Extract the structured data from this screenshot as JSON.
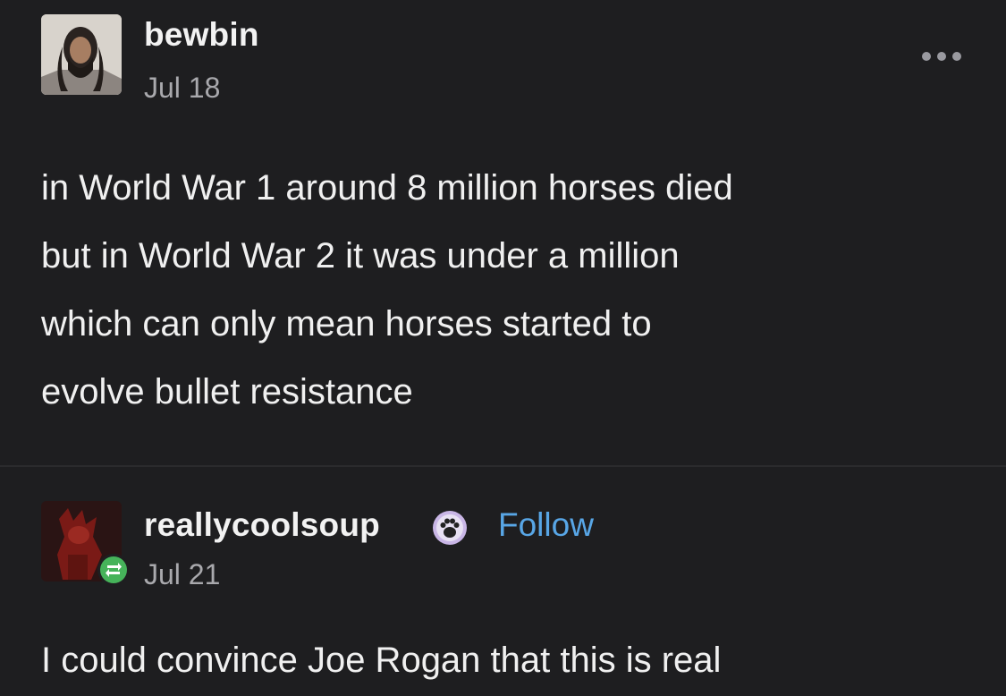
{
  "posts": [
    {
      "username": "bewbin",
      "date": "Jul 18",
      "body_lines": [
        "in World War 1 around 8 million horses died",
        "but in World War 2 it was under a million",
        "which can only mean horses started to",
        "evolve bullet resistance"
      ],
      "more_icon": "more-horizontal-icon"
    },
    {
      "username": "reallycoolsoup",
      "follow_label": "Follow",
      "date": "Jul 21",
      "body_lines": [
        "I could convince Joe Rogan that this is real"
      ],
      "badge_icon": "paw-badge-icon",
      "reblog_icon": "reblog-icon"
    }
  ],
  "colors": {
    "background": "#1e1e20",
    "text": "#f0f0f0",
    "muted": "#a9a9ad",
    "link": "#58a6e6",
    "reblog_green": "#46b35a"
  }
}
